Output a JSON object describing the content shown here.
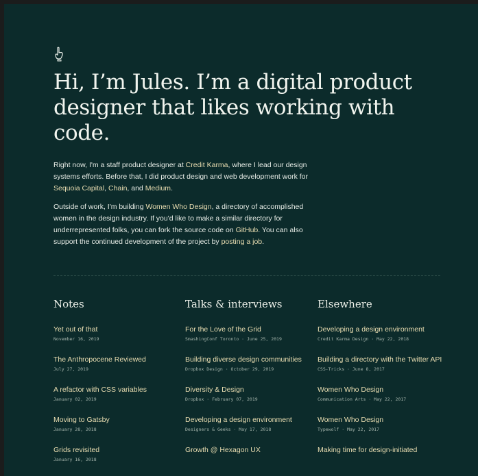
{
  "headline": "Hi, I’m Jules. I’m a digital product designer that likes working with code.",
  "intro": {
    "p1": {
      "t1": "Right now, I'm a staff product designer at ",
      "l1": "Credit Karma",
      "t2": ", where I lead our design systems efforts. Before that, I did product design and web development work for ",
      "l2": "Sequoia Capital",
      "t3": ", ",
      "l3": "Chain",
      "t4": ", and ",
      "l4": "Medium",
      "t5": "."
    },
    "p2": {
      "t1": "Outside of work, I'm building ",
      "l1": "Women Who Design",
      "t2": ", a directory of accomplished women in the design industry. If you'd like to make a similar directory for underrepresented folks, you can fork the source code on ",
      "l2": "GitHub",
      "t3": ". You can also support the continued development of the project by ",
      "l3": "posting a job",
      "t4": "."
    }
  },
  "columns": {
    "notes": {
      "heading": "Notes",
      "items": [
        {
          "title": "Yet out of that",
          "meta": "November 16, 2019"
        },
        {
          "title": "The Anthropocene Reviewed",
          "meta": "July 27, 2019"
        },
        {
          "title": "A refactor with CSS variables",
          "meta": "January 02, 2019"
        },
        {
          "title": "Moving to Gatsby",
          "meta": "January 28, 2018"
        },
        {
          "title": "Grids revisited",
          "meta": "January 16, 2018"
        }
      ]
    },
    "talks": {
      "heading": "Talks & interviews",
      "items": [
        {
          "title": "For the Love of the Grid",
          "meta": "SmashingConf Toronto · June 25, 2019"
        },
        {
          "title": "Building diverse design communities",
          "meta": "Dropbox Design · October 29, 2019"
        },
        {
          "title": "Diversity & Design",
          "meta": "Dropbox · February 07, 2019"
        },
        {
          "title": "Developing a design environment",
          "meta": "Designers & Geeks · May 17, 2018"
        },
        {
          "title": "Growth @ Hexagon UX",
          "meta": ""
        }
      ]
    },
    "elsewhere": {
      "heading": "Elsewhere",
      "items": [
        {
          "title": "Developing a design environment",
          "meta": "Credit Karma Design · May 22, 2018"
        },
        {
          "title": "Building a directory with the Twitter API",
          "meta": "CSS-Tricks · June 8, 2017"
        },
        {
          "title": "Women Who Design",
          "meta": "Communication Arts · May 22, 2017"
        },
        {
          "title": "Women Who Design",
          "meta": "Typewolf · May 22, 2017"
        },
        {
          "title": "Making time for design-initiated",
          "meta": ""
        }
      ]
    }
  },
  "colors": {
    "background": "#0c2b2b",
    "text": "#f1f4ee",
    "link": "#e9ddb1",
    "meta": "#a6b5ac"
  },
  "icons": {
    "logo": "pointing-hand-icon"
  }
}
